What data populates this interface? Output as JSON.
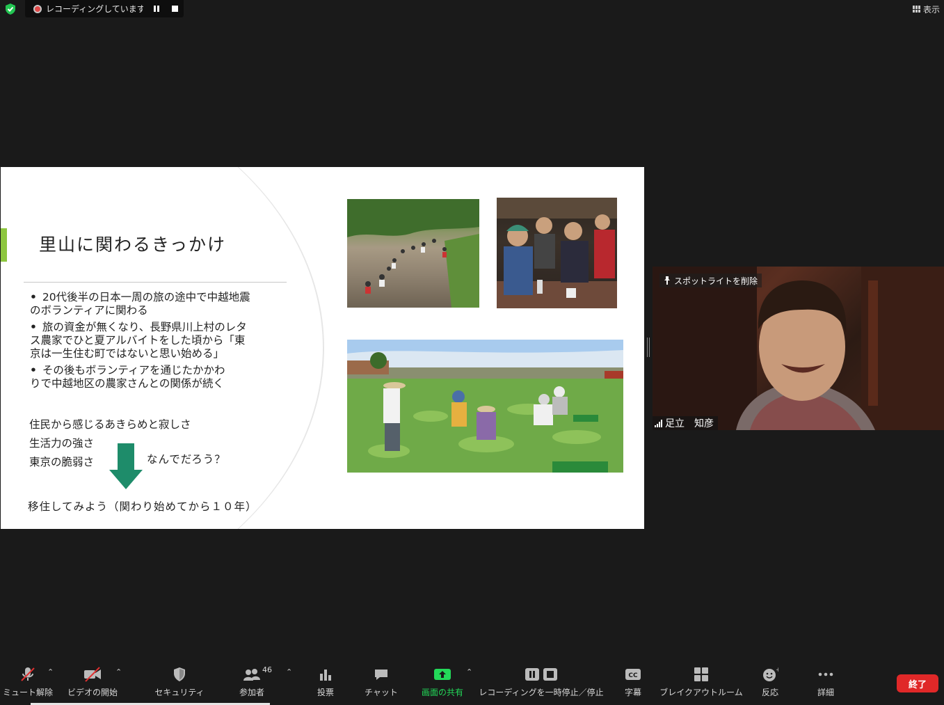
{
  "top_bar": {
    "recording_status": "レコーディングしています...",
    "view_label": "表示"
  },
  "slide": {
    "title": "里山に関わるきっかけ",
    "bullets": [
      {
        "line1": "20代後半の日本一周の旅の途中で中越地震",
        "line2": "のボランティアに関わる"
      },
      {
        "line1": "旅の資金が無くなり、長野県川上村のレタ",
        "line2": "ス農家でひと夏アルバイトをした頃から「東",
        "line3": "京は一生住む町ではないと思い始める」"
      },
      {
        "line1": "その後もボランティアを通じたかかわ",
        "line2": "りで中越地区の農家さんとの関係が続く"
      }
    ],
    "notes": [
      "住民から感じるあきらめと寂しさ",
      "生活力の強さ",
      "東京の脆弱さ"
    ],
    "why": "なんでだろう？",
    "conclusion": "移住してみよう（関わり始めてから１０年）",
    "accent_color": "#8dc63f",
    "arrow_color": "#1e8c6a"
  },
  "participant": {
    "spotlight_label": "スポットライトを削除",
    "name": "足立　知彦"
  },
  "toolbar": {
    "unmute": "ミュート解除",
    "start_video": "ビデオの開始",
    "security": "セキュリティ",
    "participants": "参加者",
    "participant_count": "46",
    "polls": "投票",
    "chat": "チャット",
    "share_screen": "画面の共有",
    "pause_stop_recording": "レコーディングを一時停止／停止",
    "captions": "字幕",
    "breakout_rooms": "ブレイクアウトルーム",
    "reactions": "反応",
    "more": "詳細",
    "end": "終了",
    "share_color": "#23d959",
    "end_color": "#e02828"
  }
}
